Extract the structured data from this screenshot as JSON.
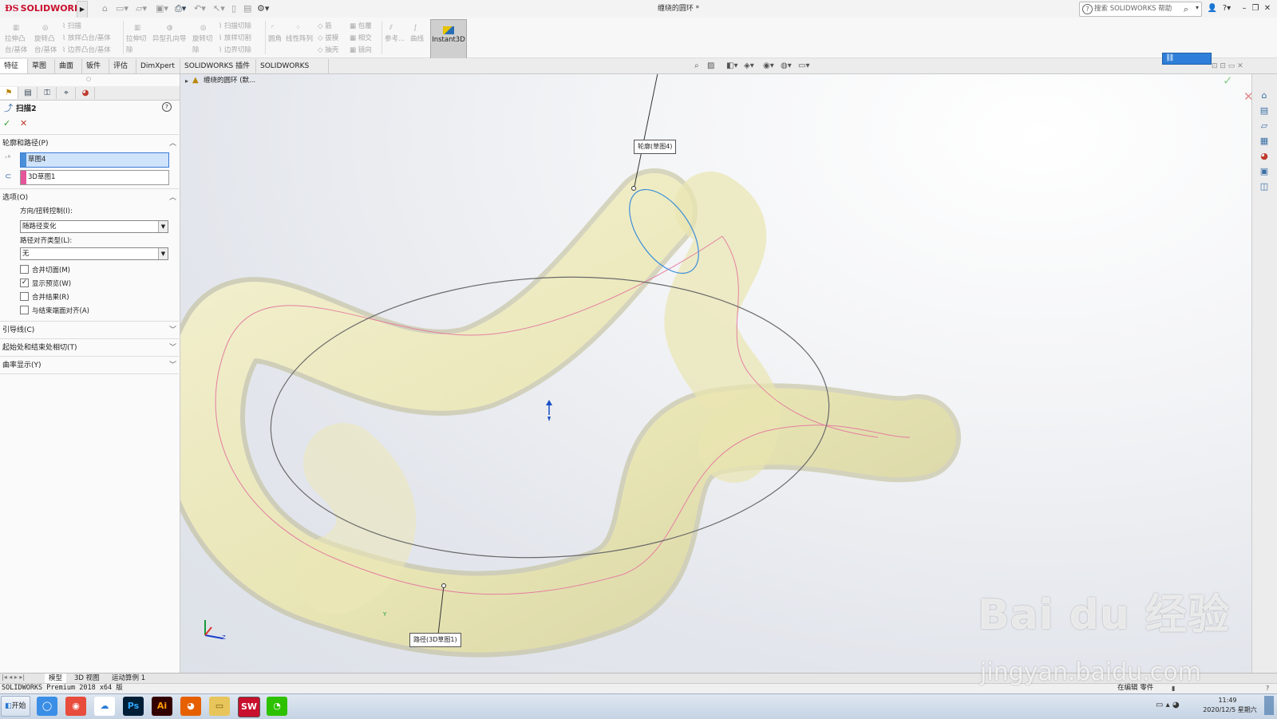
{
  "app": {
    "logo_text": "SOLIDWORKS",
    "doc_title": "缠绕的圆环 *",
    "help_search_placeholder": "搜索 SOLIDWORKS 帮助"
  },
  "command_groups": [
    {
      "items": [
        "拉伸凸",
        "台/基体"
      ]
    },
    {
      "items": [
        "旋转凸",
        "台/基体"
      ]
    },
    {
      "items": [
        "扫描",
        "放样凸台/基体",
        "边界凸台/基体"
      ]
    },
    {
      "items": [
        "拉伸切",
        "除"
      ]
    },
    {
      "items": [
        "异型孔向导"
      ]
    },
    {
      "items": [
        "旋转切",
        "除"
      ]
    },
    {
      "items": [
        "扫描切除",
        "放样切割",
        "边界切除"
      ]
    },
    {
      "items": [
        "圆角"
      ]
    },
    {
      "items": [
        "线性阵列"
      ]
    },
    {
      "items": [
        "筋",
        "拔模",
        "抽壳"
      ]
    },
    {
      "items": [
        "包覆",
        "相交",
        "镜向"
      ]
    },
    {
      "items": [
        "参考..."
      ]
    },
    {
      "items": [
        "曲线"
      ]
    }
  ],
  "instant3d_label": "Instant3D",
  "tabs": [
    "特征",
    "草图",
    "曲面",
    "钣件",
    "评估",
    "DimXpert",
    "SOLIDWORKS 插件",
    "SOLIDWORKS MBD"
  ],
  "tabs_active_index": 0,
  "feature_tree_item": "缠绕的圆环  (默...",
  "property_manager": {
    "title": "扫描2",
    "help_icon": "?",
    "ok": "✓",
    "cancel": "✕",
    "section_profile_path": "轮廓和路径(P)",
    "profile_value": "草图4",
    "path_value": "3D草图1",
    "section_options": "选项(O)",
    "orientation_label": "方向/扭转控制(I):",
    "orientation_value": "随路径变化",
    "path_align_label": "路径对齐类型(L):",
    "path_align_value": "无",
    "checkboxes": [
      {
        "label": "合并切面(M)",
        "checked": false
      },
      {
        "label": "显示预览(W)",
        "checked": true
      },
      {
        "label": "合并结果(R)",
        "checked": false
      },
      {
        "label": "与结束端面对齐(A)",
        "checked": false
      }
    ],
    "section_guide": "引导线(C)",
    "section_tangency": "起始处和结束处相切(T)",
    "section_curvature": "曲率显示(Y)"
  },
  "callouts": {
    "profile": "轮廓(草图4)",
    "path": "路径(3D草图1)"
  },
  "triad": {
    "y": "Y",
    "z": "Z"
  },
  "bottom_tabs": [
    "模型",
    "3D 视图",
    "运动算例 1"
  ],
  "bottom_tabs_active_index": 0,
  "status": {
    "left": "SOLIDWORKS Premium 2018 x64 版",
    "editing": "在编辑 零件"
  },
  "taskbar": {
    "start": "开始",
    "time": "11:49",
    "date": "2020/12/5 星期六"
  },
  "watermark": {
    "line1": "Bai du 经验",
    "line2": "jingyan.baidu.com"
  },
  "colors": {
    "solid_fill": "#f4f1c4",
    "profile_bar": "#4a90d9",
    "path_bar": "#e4559a",
    "selected_field": "#cfe3fb",
    "accent_red": "#c8102e"
  }
}
